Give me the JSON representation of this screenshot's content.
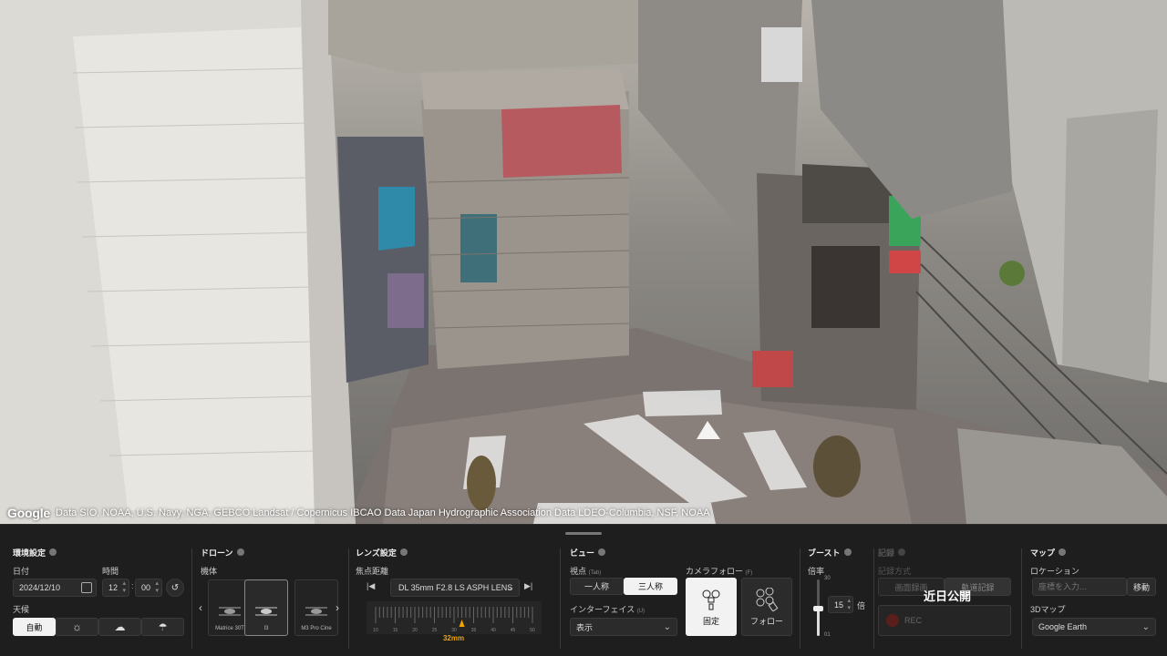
{
  "attribution": {
    "logo": "Google",
    "text": "Data SIO, NOAA, U.S. Navy, NGA, GEBCO Landsat / Copernicus IBCAO Data Japan Hydrographic Association Data LDEO-Columbia, NSF, NOAA"
  },
  "environment": {
    "title": "環境設定",
    "date_label": "日付",
    "date_value": "2024/12/10",
    "time_label": "時間",
    "hour": "12",
    "minute": "00",
    "weather_label": "天候",
    "weather_auto": "自動",
    "weather_icons": [
      "sun-icon",
      "cloud-icon",
      "rain-icon"
    ]
  },
  "drone": {
    "title": "ドローン",
    "model_label": "機体",
    "models": [
      "Matrice 30T",
      "I3",
      "M3 Pro Cine"
    ]
  },
  "lens": {
    "title": "レンズ設定",
    "focal_label": "焦点距離",
    "lens_value": "DL 35mm F2.8 LS ASPH LENS",
    "ruler_ticks": [
      "10",
      "15",
      "20",
      "25",
      "30",
      "35",
      "40",
      "45",
      "50"
    ],
    "focal_value": "32mm"
  },
  "view": {
    "title": "ビュー",
    "viewpoint_label": "視点",
    "viewpoint_hint": "(Tab)",
    "first_person": "一人称",
    "third_person": "三人称",
    "interface_label": "インターフェイス",
    "interface_hint": "(U)",
    "interface_value": "表示",
    "camera_follow_label": "カメラフォロー",
    "camera_follow_hint": "(F)",
    "fixed_label": "固定",
    "follow_label": "フォロー"
  },
  "boost": {
    "title": "ブースト",
    "rate_label": "倍率",
    "max": "30",
    "min": "01",
    "value": "15",
    "unit": "倍"
  },
  "record": {
    "title": "記録",
    "method_label": "記録方式",
    "screen_record": "画面録画",
    "track_record": "軌道記録",
    "rec": "REC",
    "coming_soon": "近日公開"
  },
  "map": {
    "title": "マップ",
    "location_label": "ロケーション",
    "location_placeholder": "座標を入力...",
    "move_button": "移動",
    "map3d_label": "3Dマップ",
    "map3d_value": "Google Earth"
  },
  "colors": {
    "panel_bg": "#1e1e1e",
    "accent": "#f0a500",
    "rec_red": "#c0392b"
  }
}
